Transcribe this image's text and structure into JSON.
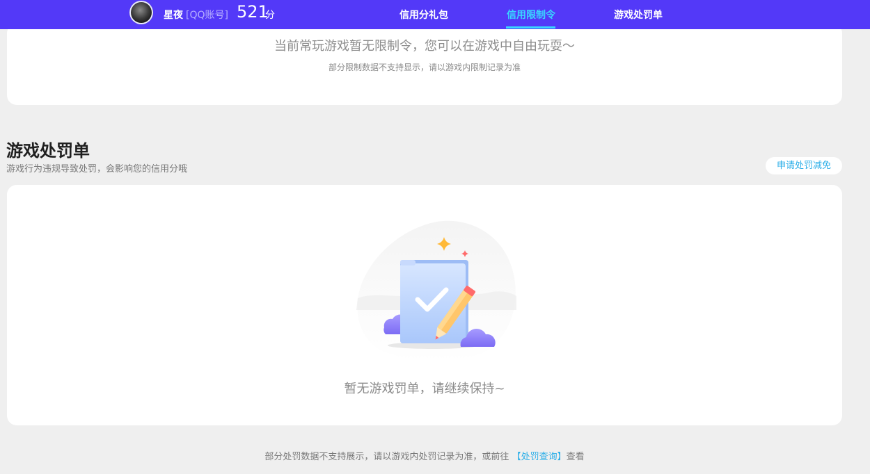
{
  "header": {
    "user_name": "星夜",
    "account_type": "[QQ账号]",
    "score": "521",
    "score_unit": "分",
    "tabs": [
      {
        "label": "信用分礼包",
        "active": false
      },
      {
        "label": "信用限制令",
        "active": true
      },
      {
        "label": "游戏处罚单",
        "active": false
      }
    ]
  },
  "restriction_card": {
    "message": "当前常玩游戏暂无限制令，您可以在游戏中自由玩耍～",
    "note": "部分限制数据不支持显示，请以游戏内限制记录为准"
  },
  "penalty_section": {
    "title": "游戏处罚单",
    "subtitle": "游戏行为违规导致处罚，会影响您的信用分哦",
    "apply_button": "申请处罚减免",
    "empty_text": "暂无游戏罚单，请继续保持~"
  },
  "footer": {
    "text_before": "部分处罚数据不支持展示，请以游戏内处罚记录为准，或前往",
    "link": "【处罚查询】",
    "text_after": "查看"
  },
  "colors": {
    "header_bg": "#5339f8",
    "active_tab": "#39d6ff",
    "link": "#2aaee8",
    "page_bg": "#efefef"
  },
  "icons": [
    "avatar",
    "empty-clipboard-illustration"
  ]
}
